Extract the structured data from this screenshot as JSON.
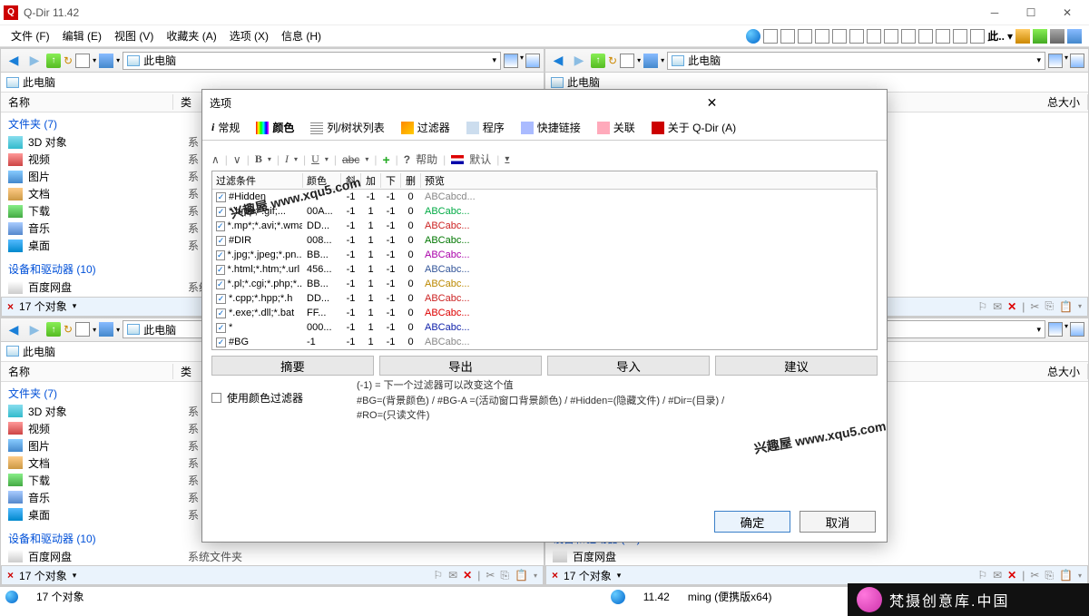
{
  "app": {
    "title": "Q-Dir 11.42"
  },
  "menus": {
    "file": "文件 (F)",
    "edit": "编辑 (E)",
    "view": "视图 (V)",
    "fav": "收藏夹 (A)",
    "opt": "选项 (X)",
    "info": "信息 (H)",
    "right_label": "此.."
  },
  "pane": {
    "addr": "此电脑",
    "crumb": "此电脑",
    "col_name": "名称",
    "col_type": "类",
    "col_size": "总大小",
    "group_folders": "文件夹 (7)",
    "group_devices": "设备和驱动器 (10)",
    "item_baidu": "百度网盘",
    "items": [
      {
        "t": "3D 对象",
        "ic": "folder3d",
        "s": "系"
      },
      {
        "t": "视频",
        "ic": "foldervid",
        "s": "系"
      },
      {
        "t": "图片",
        "ic": "folderpic",
        "s": "系"
      },
      {
        "t": "文档",
        "ic": "folderdoc",
        "s": "系"
      },
      {
        "t": "下载",
        "ic": "folderdl",
        "s": "系"
      },
      {
        "t": "音乐",
        "ic": "foldermus",
        "s": "系"
      },
      {
        "t": "桌面",
        "ic": "folderdesk",
        "s": "系"
      }
    ],
    "status": "17 个对象",
    "sysfolder": "系统文件夹"
  },
  "dialog": {
    "title": "选项",
    "tabs": {
      "general": "常规",
      "color": "颜色",
      "list": "列/树状列表",
      "filter": "过滤器",
      "prog": "程序",
      "link": "快捷链接",
      "assoc": "关联",
      "about": "关于 Q-Dir (A)"
    },
    "fmt": {
      "help": "帮助",
      "default": "默认"
    },
    "grid": {
      "h_cond": "过滤条件",
      "h_color": "颜色",
      "h_it": "斜",
      "h_add": "加",
      "h_u": "下",
      "h_del": "删",
      "h_prev": "预览",
      "rows": [
        {
          "cond": "#Hidden",
          "color": "",
          "it": "-1",
          "add": "-1",
          "u": "-1",
          "del": "0",
          "prev": "ABCabcd...",
          "c": "#888"
        },
        {
          "cond": "*.bmp;*.gif;...",
          "color": "00A...",
          "it": "-1",
          "add": "1",
          "u": "-1",
          "del": "0",
          "prev": "ABCabc...",
          "c": "#0a4"
        },
        {
          "cond": "*.mp*;*.avi;*.wma;",
          "color": "DD...",
          "it": "-1",
          "add": "1",
          "u": "-1",
          "del": "0",
          "prev": "ABCabc...",
          "c": "#c22"
        },
        {
          "cond": "#DIR",
          "color": "008...",
          "it": "-1",
          "add": "1",
          "u": "-1",
          "del": "0",
          "prev": "ABCabc...",
          "c": "#070"
        },
        {
          "cond": "*.jpg;*.jpeg;*.pn...",
          "color": "BB...",
          "it": "-1",
          "add": "1",
          "u": "-1",
          "del": "0",
          "prev": "ABCabc...",
          "c": "#a0a"
        },
        {
          "cond": "*.html;*.htm;*.url",
          "color": "456...",
          "it": "-1",
          "add": "1",
          "u": "-1",
          "del": "0",
          "prev": "ABCabc...",
          "c": "#359"
        },
        {
          "cond": "*.pl;*.cgi;*.php;*...",
          "color": "BB...",
          "it": "-1",
          "add": "1",
          "u": "-1",
          "del": "0",
          "prev": "ABCabc...",
          "c": "#b80"
        },
        {
          "cond": "*.cpp;*.hpp;*.h",
          "color": "DD...",
          "it": "-1",
          "add": "1",
          "u": "-1",
          "del": "0",
          "prev": "ABCabc...",
          "c": "#c22"
        },
        {
          "cond": "*.exe;*.dll;*.bat",
          "color": "FF...",
          "it": "-1",
          "add": "1",
          "u": "-1",
          "del": "0",
          "prev": "ABCabc...",
          "c": "#d00"
        },
        {
          "cond": "*",
          "color": "000...",
          "it": "-1",
          "add": "1",
          "u": "-1",
          "del": "0",
          "prev": "ABCabc...",
          "c": "#12a"
        },
        {
          "cond": "#BG",
          "color": "-1",
          "it": "-1",
          "add": "1",
          "u": "-1",
          "del": "0",
          "prev": "ABCabc...",
          "c": "#888"
        }
      ]
    },
    "btns": {
      "summary": "摘要",
      "export": "导出",
      "import": "导入",
      "suggest": "建议"
    },
    "use_filter": "使用颜色过滤器",
    "help1": "(-1) = 下一个过滤器可以改变这个值",
    "help2": "#BG=(背景颜色) / #BG-A =(活动窗口背景颜色) / #Hidden=(隐藏文件) / #Dir=(目录) /",
    "help3": "#RO=(只读文件)",
    "ok": "确定",
    "cancel": "取消"
  },
  "bottom": {
    "obj": "17 个对象",
    "ver": "11.42",
    "build": "ming (便携版x64)",
    "loc": "此电脑"
  },
  "wm1": "兴趣屋 www.xqu5.com",
  "wm2": "兴趣屋 www.xqu5.com",
  "brand": "梵摄创意库.中国"
}
